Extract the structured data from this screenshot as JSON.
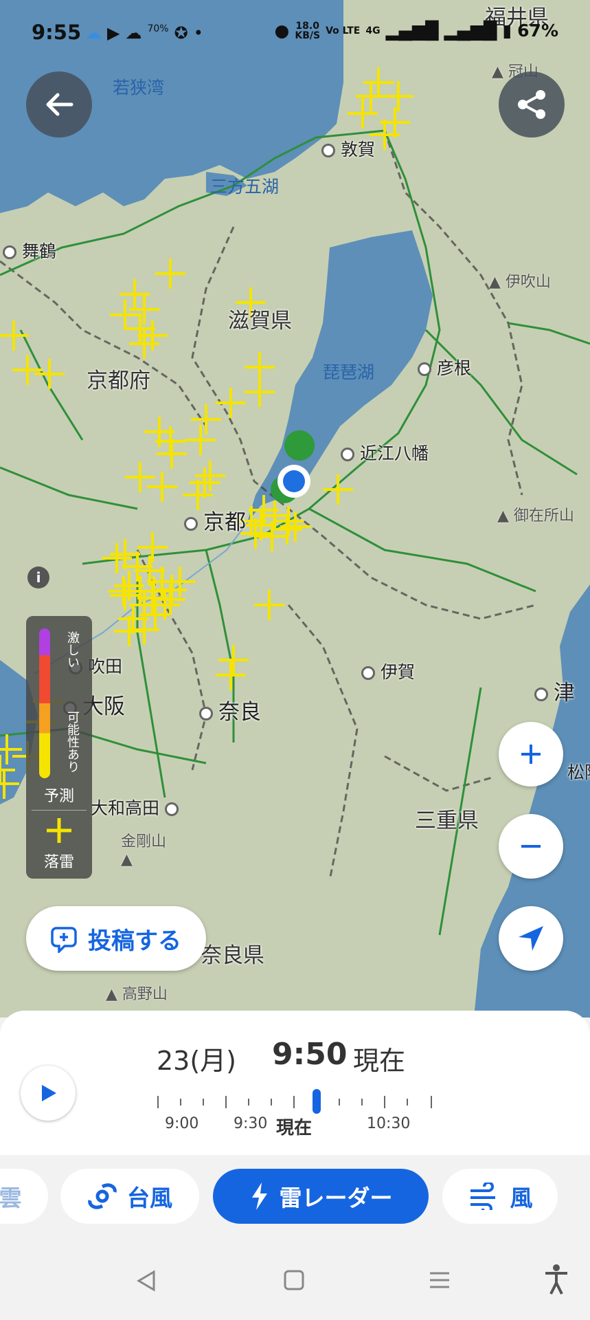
{
  "status_bar": {
    "time": "9:55",
    "net_speed": "18.0",
    "net_unit": "KB/S",
    "net_type": "Vo LTE",
    "signal": "4G",
    "battery": "67%",
    "weather_temp": "70%"
  },
  "map": {
    "prefectures": [
      "福井県",
      "滋賀県",
      "京都府",
      "三重県",
      "奈良県"
    ],
    "waters": [
      "若狭湾",
      "三方五湖",
      "琵琶湖"
    ],
    "cities": {
      "tsuruga": "敦賀",
      "maizuru": "舞鶴",
      "hikone": "彦根",
      "omihachiman": "近江八幡",
      "kyoto": "京都",
      "suita": "吹田",
      "osaka": "大阪",
      "nara": "奈良",
      "iga": "伊賀",
      "tsu": "津",
      "matsusaka": "松阪",
      "yamatotakada": "大和高田"
    },
    "mountains": {
      "kanmuri": "冠山",
      "ibuki": "伊吹山",
      "gozaisho": "御在所山",
      "kongo": "金剛山",
      "koya": "高野山"
    }
  },
  "legend": {
    "heavy": "激しい",
    "possible": "可能性あり",
    "forecast": "予測",
    "lightning": "落雷",
    "colors": [
      "#b040e0",
      "#f04a32",
      "#f6a020",
      "#f5e400"
    ]
  },
  "post_button": "投稿する",
  "timeline": {
    "date": "23(月)",
    "time": "9:50",
    "now": "現在",
    "labels": [
      "9:00",
      "9:30",
      "現在",
      "10:30"
    ]
  },
  "tabs": {
    "cloud_partial": "雲",
    "typhoon": "台風",
    "radar": "雷レーダー",
    "wind": "風"
  },
  "colors": {
    "accent": "#1565e0",
    "lightning": "#f5e400",
    "land": "#c9d1b4",
    "sea": "#5d8fb8",
    "road": "#2f8f3a"
  }
}
